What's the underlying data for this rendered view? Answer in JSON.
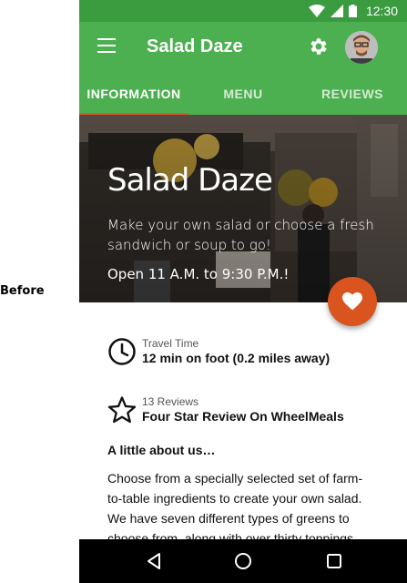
{
  "annotation": {
    "before_label": "Before"
  },
  "status_bar": {
    "time": "12:30",
    "icons": [
      "wifi-icon",
      "signal-icon",
      "battery-icon"
    ]
  },
  "app_bar": {
    "title": "Salad Daze",
    "menu_icon": "menu-icon",
    "settings_icon": "gear-icon",
    "avatar": "avatar"
  },
  "tabs": [
    {
      "label": "INFORMATION",
      "active": true
    },
    {
      "label": "MENU",
      "active": false
    },
    {
      "label": "REVIEWS",
      "active": false
    }
  ],
  "hero": {
    "title": "Salad Daze",
    "description": "Make your own salad or choose a fresh sandwich or soup to go!",
    "hours": "Open 11 A.M. to 9:30 P.M.!"
  },
  "fab": {
    "icon": "heart-icon"
  },
  "travel": {
    "label": "Travel Time",
    "value": "12 min on foot (0.2 miles away)",
    "icon": "clock-icon"
  },
  "reviews": {
    "label": "13 Reviews",
    "value": "Four Star Review On WheelMeals",
    "icon": "star-icon"
  },
  "about": {
    "heading": "A little about us…",
    "body": "Choose from a specially selected set of farm-to-table ingredients to create your own salad. We have seven different types of greens to choose from, along with over thirty toppings"
  },
  "nav_bar": {
    "icons": [
      "back-icon",
      "home-icon",
      "recents-icon"
    ]
  },
  "colors": {
    "primary": "#4caf50",
    "primary_dark": "#3a9b3f",
    "accent": "#d9541f"
  }
}
